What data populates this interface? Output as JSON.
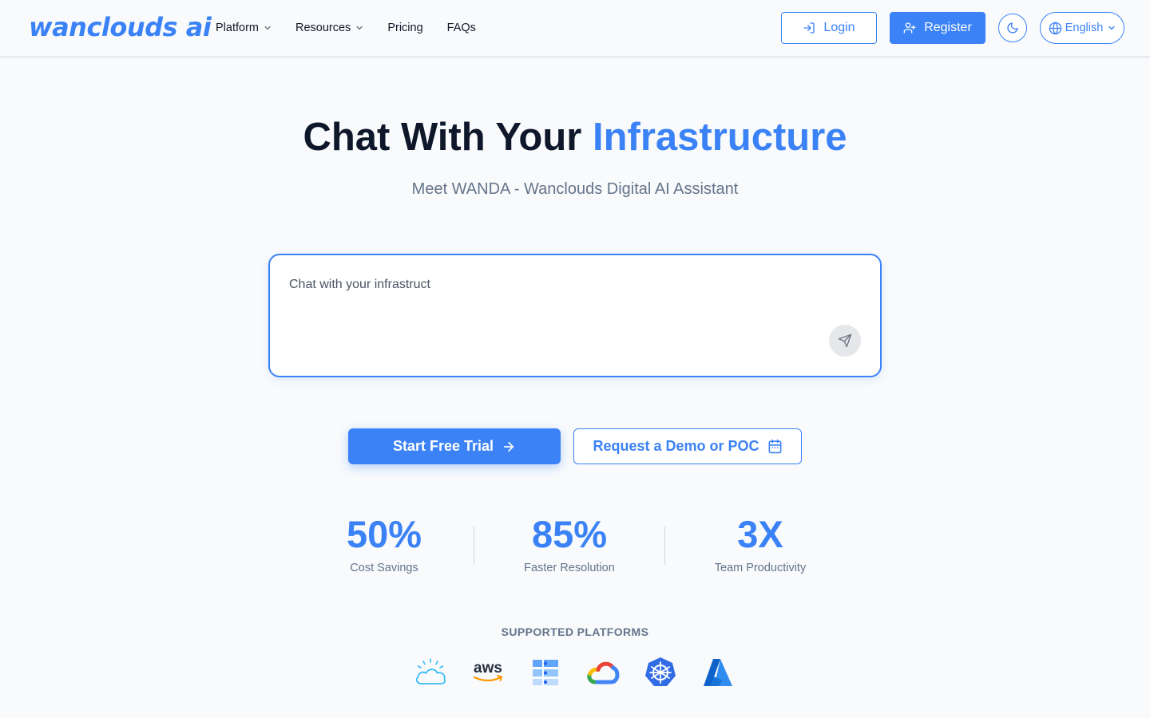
{
  "header": {
    "logo_text": "wanclouds ai",
    "nav": [
      {
        "label": "Platform",
        "has_dropdown": true
      },
      {
        "label": "Resources",
        "has_dropdown": true
      },
      {
        "label": "Pricing",
        "has_dropdown": false
      },
      {
        "label": "FAQs",
        "has_dropdown": false
      }
    ],
    "login_label": "Login",
    "register_label": "Register",
    "theme_icon": "moon-icon",
    "language_label": "English"
  },
  "hero": {
    "title_main": "Chat With Your ",
    "title_accent": "Infrastructure",
    "subtitle": "Meet WANDA - Wanclouds Digital AI Assistant"
  },
  "chat": {
    "placeholder": "Chat with your infrastruct",
    "send_icon": "send-icon"
  },
  "cta": {
    "primary_label": "Start Free Trial",
    "secondary_label": "Request a Demo or POC"
  },
  "stats": [
    {
      "value": "50%",
      "label": "Cost Savings"
    },
    {
      "value": "85%",
      "label": "Faster Resolution"
    },
    {
      "value": "3X",
      "label": "Team Productivity"
    }
  ],
  "platforms": {
    "heading": "SUPPORTED PLATFORMS",
    "logos": [
      {
        "name": "ibm-cloud-logo"
      },
      {
        "name": "aws-logo",
        "text": "aws"
      },
      {
        "name": "ibm-power-logo"
      },
      {
        "name": "google-cloud-logo"
      },
      {
        "name": "kubernetes-logo"
      },
      {
        "name": "azure-logo"
      }
    ]
  },
  "colors": {
    "accent": "#3b82f6",
    "text_dark": "#0f172a",
    "text_muted": "#64748b",
    "background": "#f8fafc"
  }
}
